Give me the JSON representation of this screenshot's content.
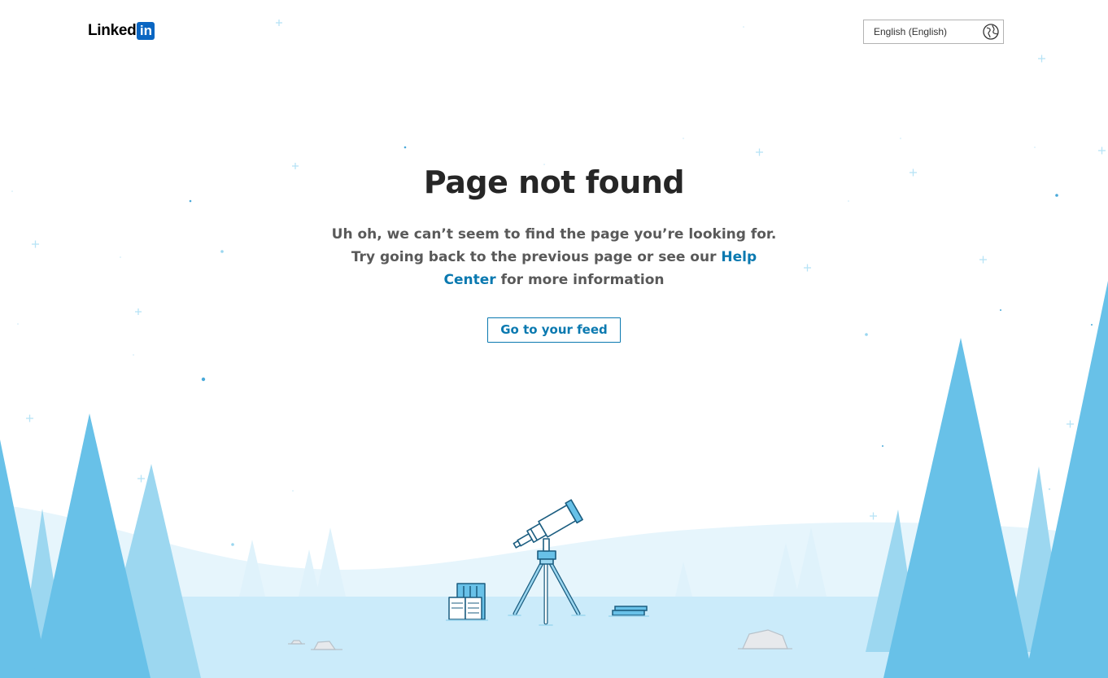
{
  "header": {
    "logo_text": "Linked",
    "logo_box_text": "in",
    "language_select": "English (English)",
    "language_icon": "globe-icon"
  },
  "main": {
    "title": "Page not found",
    "description_part1": "Uh oh, we can’t seem to find the page you’re looking for. Try going back to the previous page or see our ",
    "help_link": "Help Center",
    "description_part2": " for more information",
    "feed_button": "Go to your feed"
  },
  "illustration": {
    "icons": [
      "telescope-icon",
      "books-icon",
      "rock-icon",
      "tree-icon",
      "star-icon"
    ]
  },
  "colors": {
    "brand": "#0a66c2",
    "link": "#0a79b0",
    "tree_dark": "#68c1e8",
    "tree_light": "#9cd7f0",
    "ground": "#cbebfa",
    "hill": "#e6f5fc"
  }
}
